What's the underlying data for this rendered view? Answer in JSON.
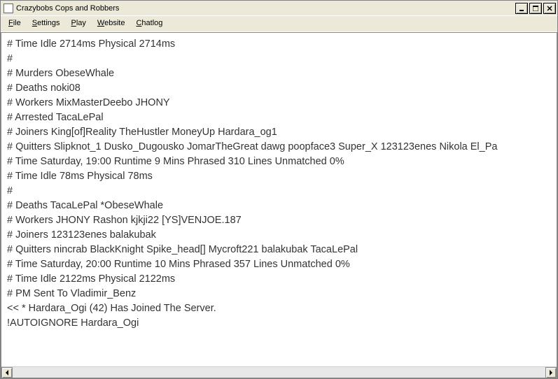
{
  "window": {
    "title": "Crazybobs Cops and Robbers"
  },
  "menu": {
    "file": "File",
    "settings": "Settings",
    "play": "Play",
    "website": "Website",
    "chatlog": "Chatlog"
  },
  "log": {
    "lines": [
      "# Time       Idle 2714ms Physical 2714ms",
      "#",
      "# Murders ObeseWhale",
      "# Deaths   noki08",
      "# Workers MixMasterDeebo JHONY",
      "# Arrested TacaLePal",
      "# Joiners   King[of]Reality TheHustler MoneyUp Hardara_og1",
      "# Quitters   Slipknot_1 Dusko_Dugousko JomarTheGreat dawg poopface3 Super_X 123123enes Nikola El_Pa",
      "# Time      Saturday, 19:00 Runtime 9 Mins Phrased 310 Lines Unmatched  0%",
      "# Time       Idle 78ms Physical 78ms",
      "#",
      "# Deaths   TacaLePal *ObeseWhale",
      "# Workers JHONY Rashon kjkji22 [YS]VENJOE.187",
      "# Joiners   123123enes balakubak",
      "# Quitters   nincrab BlackKnight Spike_head[] Mycroft221 balakubak TacaLePal",
      "# Time      Saturday, 20:00 Runtime 10 Mins Phrased 357 Lines Unmatched  0%",
      "# Time       Idle 2122ms Physical 2122ms",
      "# PM Sent To Vladimir_Benz",
      "<< * Hardara_Ogi (42) Has Joined The Server.",
      " !AUTOIGNORE Hardara_Ogi"
    ]
  }
}
